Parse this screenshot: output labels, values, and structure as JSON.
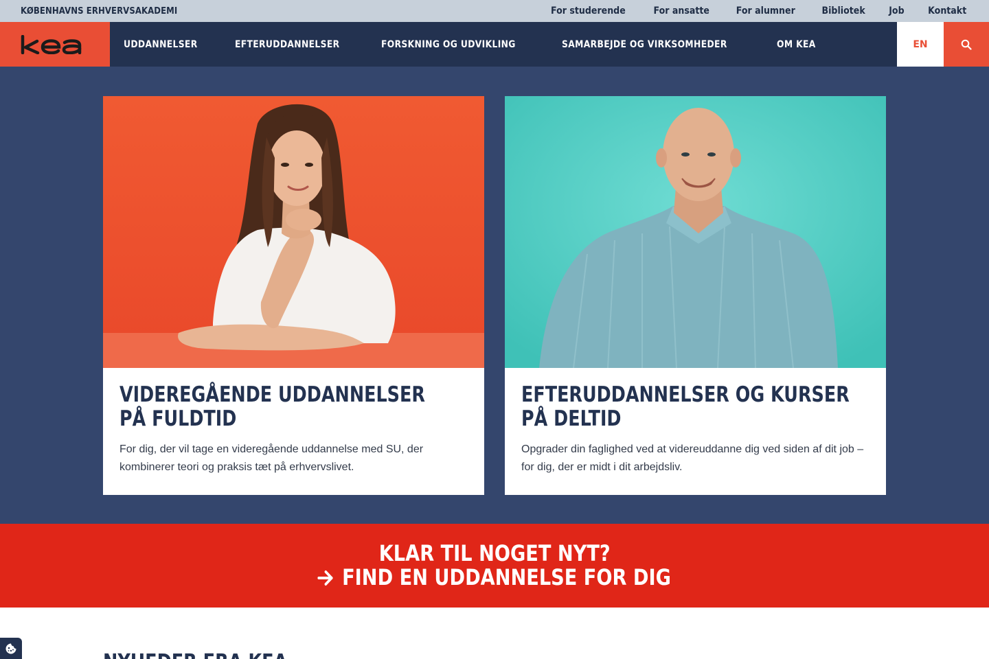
{
  "utility": {
    "org_name": "KØBENHAVNS ERHVERVSAKADEMI",
    "links": [
      "For studerende",
      "For ansatte",
      "For alumner",
      "Bibliotek",
      "Job",
      "Kontakt"
    ]
  },
  "nav": {
    "logo_text": "kea",
    "items": [
      "UDDANNELSER",
      "EFTERUDDANNELSER",
      "FORSKNING OG UDVIKLING",
      "SAMARBEJDE OG VIRKSOMHEDER",
      "OM KEA"
    ],
    "lang": "EN",
    "search_icon": "search-icon"
  },
  "cards": [
    {
      "title_line1": "VIDEREGÅENDE UDDANNELSER",
      "title_line2": "PÅ FULDTID",
      "text": "For dig, der vil tage en videregående uddannelse med SU, der kombinerer teori og praksis tæt på erhvervslivet.",
      "photo_bg": "#ef5330"
    },
    {
      "title_line1": "EFTERUDDANNELSER OG KURSER",
      "title_line2": "PÅ DELTID",
      "text": "Opgrader din faglighed ved at videreuddanne dig ved siden af dit job – for dig, der er midt i dit arbejdsliv.",
      "photo_bg": "#56cfc5"
    }
  ],
  "cta": {
    "line1": "KLAR TIL NOGET NYT?",
    "line2": "FIND EN UDDANNELSE FOR DIG"
  },
  "news": {
    "heading": "NYHEDER FRA KEA"
  },
  "colors": {
    "brand_red": "#e94e35",
    "navy": "#233250",
    "hero_bg": "#34466d",
    "cta_red": "#e02618"
  }
}
